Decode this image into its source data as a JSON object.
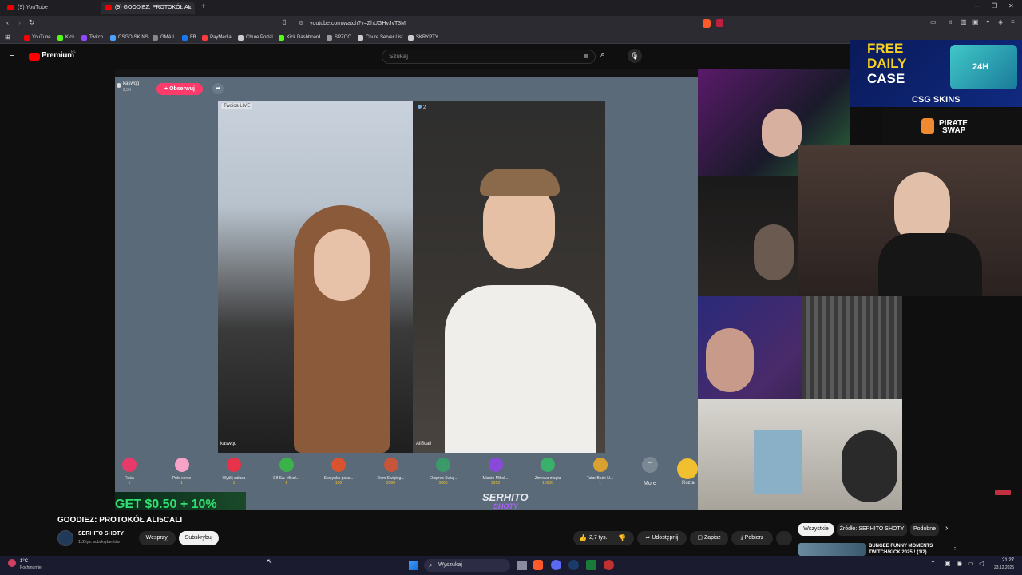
{
  "browser": {
    "tabs": [
      {
        "label": "(9) YouTube"
      },
      {
        "label": "(9) GOODIEZ: PROTOKÓŁ ALI"
      }
    ],
    "url": "youtube.com/watch?v=ZhUGHvJvT3M",
    "new_tab_symbol": "+",
    "close_symbol": "×"
  },
  "bookmarks": [
    {
      "label": "YouTube",
      "color": "#ff0000"
    },
    {
      "label": "Kick",
      "color": "#53fc18"
    },
    {
      "label": "Twitch",
      "color": "#9146ff"
    },
    {
      "label": "CSGO-SKINS",
      "color": "#4aa3ff"
    },
    {
      "label": "GMAIL",
      "color": "#888888"
    },
    {
      "label": "FB",
      "color": "#1877f2"
    },
    {
      "label": "PayMedia",
      "color": "#ff3b3b"
    },
    {
      "label": "Chure Portal",
      "color": "#cccccc"
    },
    {
      "label": "Kick Dashboard",
      "color": "#53fc18"
    },
    {
      "label": "SPZOO",
      "color": "#999999"
    },
    {
      "label": "Chure Server List",
      "color": "#cccccc"
    },
    {
      "label": "SKRYPTY",
      "color": "#cccccc"
    }
  ],
  "youtube": {
    "logo_text": "Premium",
    "logo_region": "PL",
    "search_placeholder": "Szukaj",
    "video_title": "GOODIEZ: PROTOKÓŁ ALI5CALI",
    "channel_name": "SERHITO SHOTY",
    "subscribers": "112 tys. subskrybentów",
    "support_label": "Wesprzyj",
    "subscribe_label": "Subskrybuj",
    "likes": "2,7 tys.",
    "share_label": "Udostępnij",
    "save_label": "Zapisz",
    "download_label": "Pobierz",
    "more_symbol": "⋯",
    "chips": [
      "Wszystkie",
      "Źródło: SERHITO SHOTY",
      "Podobne"
    ],
    "recommended_title_1": "BUNGEE FUNNY MOMENTS",
    "recommended_title_2": "TWITCH/KICK 2025!! (1/2)"
  },
  "video_overlay": {
    "streamer": "kaswqq",
    "streamer_sub": "2,3K",
    "follow_label": "+ Obserwuj",
    "left_cam_label": "Twoica LIVE",
    "right_cam_count": "2",
    "left_name": "kaswqq",
    "right_name": "Ali5cali",
    "gifts": [
      {
        "name": "Róża",
        "count": "1",
        "color": "#e83a6a"
      },
      {
        "name": "Pułe serce",
        "count": "1",
        "color": "#f7a3c8"
      },
      {
        "name": "Wyślij całusa",
        "count": "1",
        "color": "#e8324a"
      },
      {
        "name": "Elf Św. Mikoł...",
        "count": "1",
        "color": "#3bb24a"
      },
      {
        "name": "Skrzynka pocz...",
        "count": "100",
        "color": "#d9532f"
      },
      {
        "name": "Dom Świąteg...",
        "count": "2000",
        "color": "#c8553a"
      },
      {
        "name": "Ekspres Świą...",
        "count": "5000",
        "color": "#3a9a6a"
      },
      {
        "name": "Miasto Mikoł...",
        "count": "9999",
        "color": "#8a4ad9"
      },
      {
        "name": "Zimowa magia",
        "count": "10000",
        "color": "#3ab06a"
      },
      {
        "name": "Tatar Boże N...",
        "count": "1",
        "color": "#d9a12f"
      }
    ],
    "more_label": "More",
    "extra_label": "Rozta",
    "watermark_1": "SERHITO",
    "watermark_2": "SHOTY",
    "promo_text": "GET $0.50 + 10%"
  },
  "ads": {
    "csg_line1": "FREE",
    "csg_line2": "DAILY",
    "csg_line3": "CASE",
    "csg_brand": "CSG SKINS",
    "csg_badge": "24H",
    "pirate_line1": "PIRATE",
    "pirate_line2": "SWAP"
  },
  "taskbar": {
    "weather_temp": "1°C",
    "weather_desc": "Pochmurnie",
    "search_label": "Wyszukaj",
    "time": "21:27",
    "date": "23.12.2025"
  },
  "colors": {
    "accent_red": "#ff0000",
    "follow_pink": "#ff3b6b",
    "csg_gold": "#f5d020",
    "taskbar": "#1b1b2f"
  }
}
